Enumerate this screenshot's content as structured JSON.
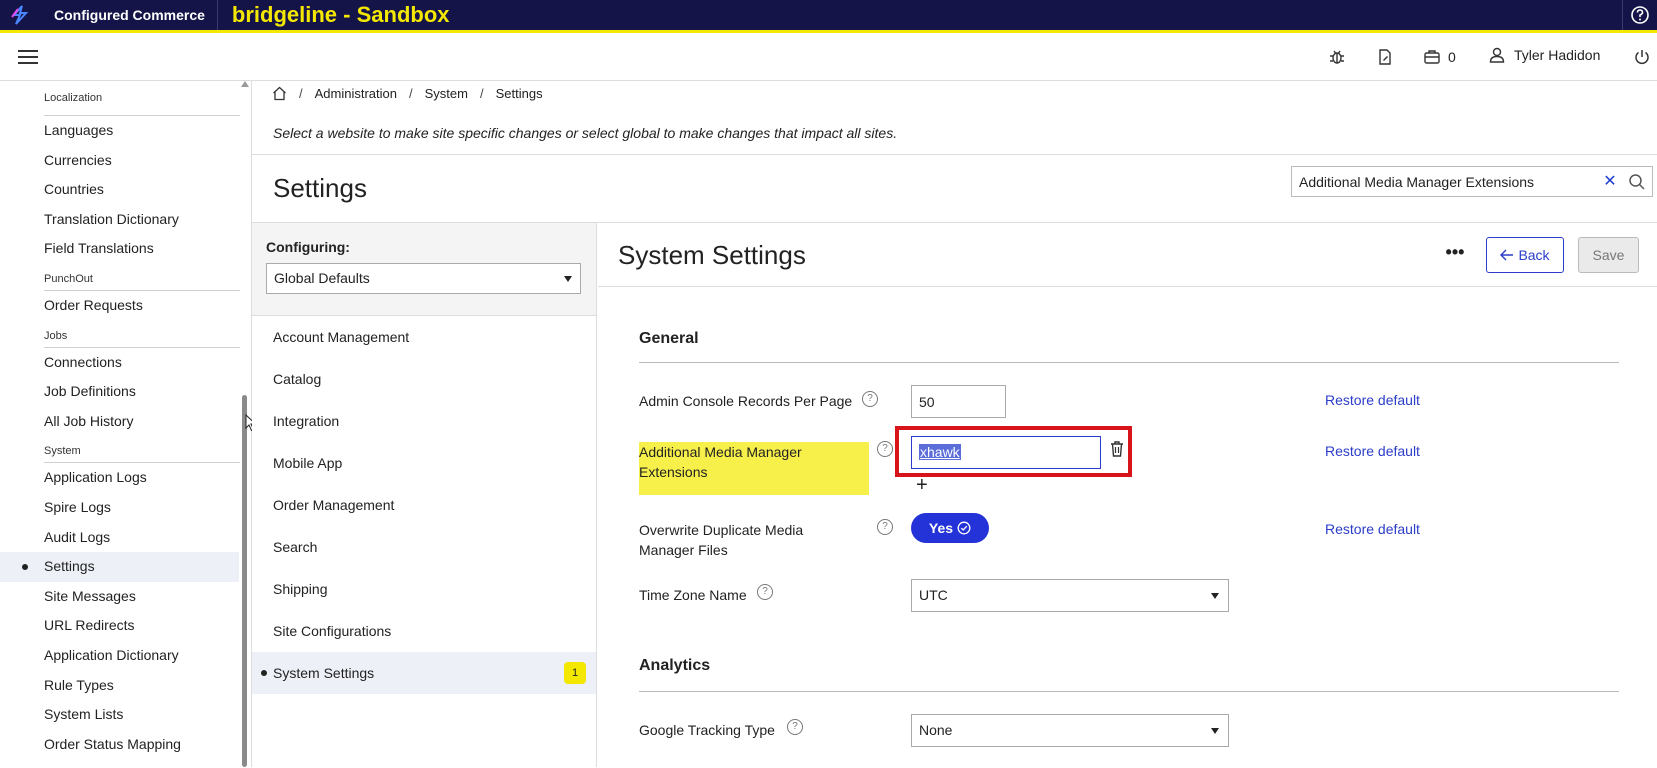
{
  "topbar": {
    "app_name": "Configured Commerce",
    "environment": "bridgeline - Sandbox",
    "accent_color": "#f4e800",
    "bg_color": "#141448"
  },
  "header": {
    "cart_count": "0",
    "user_name": "Tyler Hadidon",
    "icons": [
      "menu-icon",
      "bug-icon",
      "document-edit-icon",
      "briefcase-icon",
      "user-icon",
      "power-icon"
    ]
  },
  "leftnav": {
    "sections": [
      {
        "title": "Localization",
        "items": [
          "Languages",
          "Currencies",
          "Countries",
          "Translation Dictionary",
          "Field Translations"
        ]
      },
      {
        "title": "PunchOut",
        "items": [
          "Order Requests"
        ]
      },
      {
        "title": "Jobs",
        "items": [
          "Connections",
          "Job Definitions",
          "All Job History"
        ]
      },
      {
        "title": "System",
        "items": [
          "Application Logs",
          "Spire Logs",
          "Audit Logs",
          "Settings",
          "Site Messages",
          "URL Redirects",
          "Application Dictionary",
          "Rule Types",
          "System Lists",
          "Order Status Mapping"
        ]
      }
    ],
    "active_item": "Settings"
  },
  "breadcrumb": {
    "items": [
      "Administration",
      "System",
      "Settings"
    ],
    "separator": "/"
  },
  "info_text": "Select a website to make site specific changes or select global to make changes that impact all sites.",
  "page_title": "Settings",
  "search": {
    "value": "Additional Media Manager Extensions"
  },
  "config": {
    "label": "Configuring:",
    "selected": "Global Defaults",
    "categories": [
      "Account Management",
      "Catalog",
      "Integration",
      "Mobile App",
      "Order Management",
      "Search",
      "Shipping",
      "Site Configurations",
      "System Settings"
    ],
    "active_category": "System Settings",
    "active_badge": "1"
  },
  "main": {
    "title": "System Settings",
    "more_label": "•••",
    "back_label": "Back",
    "save_label": "Save",
    "restore_label": "Restore default",
    "general": {
      "heading": "General",
      "records_label": "Admin Console Records Per Page",
      "records_value": "50",
      "extensions_label_line1": "Additional Media Manager",
      "extensions_label_line2": "Extensions",
      "extensions_value": "xhawk",
      "overwrite_label_line1": "Overwrite Duplicate Media",
      "overwrite_label_line2": "Manager Files",
      "overwrite_value": "Yes",
      "timezone_label": "Time Zone Name",
      "timezone_value": "UTC"
    },
    "analytics": {
      "heading": "Analytics",
      "tracking_label": "Google Tracking Type",
      "tracking_value": "None"
    }
  }
}
